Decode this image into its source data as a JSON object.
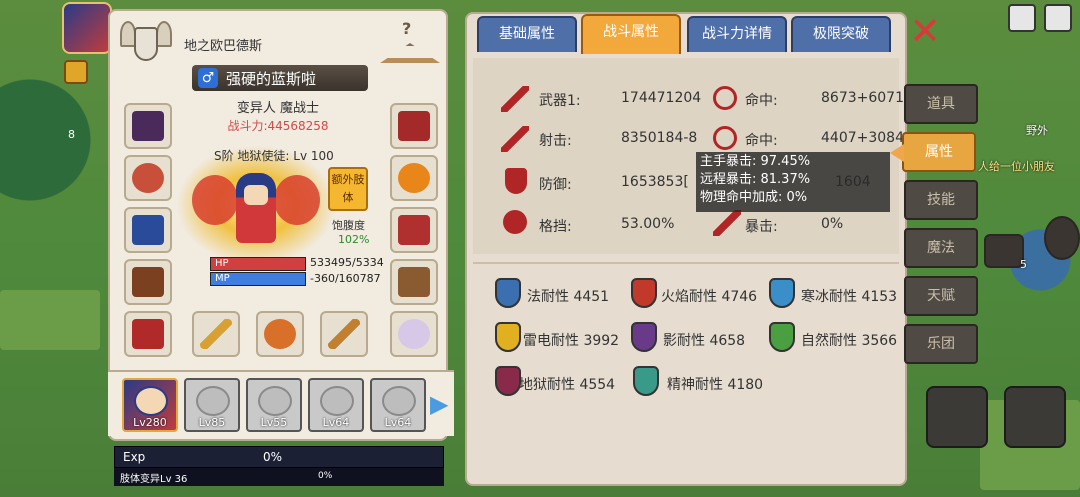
{
  "left_panel": {
    "guild_name": "地之欧巴德斯",
    "hanger_hint": "?",
    "gender": "♂",
    "character_name": "强硬的蓝斯啦",
    "class_line": "变异人 魔战士",
    "combat_power": "战斗力:44568258",
    "rank_level": "S阶 地狱使徒: Lv 100",
    "extra_body_label": "额外肢体",
    "satiety_label": "饱腹度",
    "satiety_value": "102%",
    "hp_label": "HP",
    "mp_label": "MP",
    "hp_value": "533495/5334",
    "mp_value": "-360/160787"
  },
  "party": [
    {
      "level": "Lv280",
      "active": true
    },
    {
      "level": "Lv85",
      "active": false
    },
    {
      "level": "Lv55",
      "active": false
    },
    {
      "level": "Lv64",
      "active": false
    },
    {
      "level": "Lv64",
      "active": false
    }
  ],
  "exp": {
    "label": "Exp",
    "value": "0%",
    "sub_label": "肢体变异Lv 36",
    "sub_value": "0%"
  },
  "tabs": [
    "基础属性",
    "战斗属性",
    "战斗力详情",
    "极限突破"
  ],
  "active_tab": "战斗属性",
  "stats": {
    "weapon1_label": "武器1:",
    "weapon1_value": "174471204",
    "hit1_label": "命中:",
    "hit1_value": "8673+6071",
    "shoot_label": "射击:",
    "shoot_value": "8350184-8",
    "hit2_label": "命中:",
    "hit2_value": "4407+3084",
    "defense_label": "防御:",
    "defense_value": "1653853[",
    "defense_extra": "1604",
    "block_label": "格挡:",
    "block_value": "53.00%",
    "crit_label": "暴击:",
    "crit_value": "0%"
  },
  "tooltip": {
    "line1": "主手暴击: 97.45%",
    "line2": "远程暴击: 81.37%",
    "line3": "物理命中加成: 0%"
  },
  "resistances": [
    {
      "label": "法耐性 4451",
      "color": "#3c6fb0"
    },
    {
      "label": "火焰耐性 4746",
      "color": "#c0392b"
    },
    {
      "label": "寒冰耐性 4153",
      "color": "#3a8fc9"
    },
    {
      "label": "雷电耐性 3992",
      "color": "#e0b020"
    },
    {
      "label": "影耐性 4658",
      "color": "#6a3a8a"
    },
    {
      "label": "自然耐性 3566",
      "color": "#4aa040"
    },
    {
      "label": "地狱耐性 4554",
      "color": "#8a2a4a"
    },
    {
      "label": "精神耐性 4180",
      "color": "#3a9a8a"
    }
  ],
  "side_nav": [
    "道具",
    "属性",
    "技能",
    "魔法",
    "天赋",
    "乐团"
  ],
  "side_nav_active": "属性",
  "map": {
    "area_label": "野外",
    "message_snippet": "人给一位小朋友",
    "counter": "5",
    "gem_count": "8"
  },
  "colors": {
    "tab_active": "#f2a83a",
    "tab_inactive": "#4f6fa8",
    "stat_icon": "#b02626",
    "power_text": "#d24a4a"
  }
}
